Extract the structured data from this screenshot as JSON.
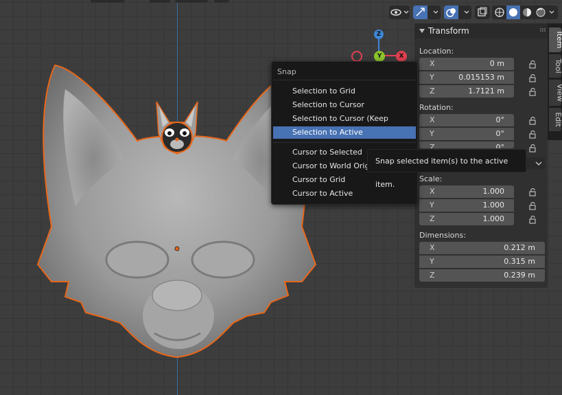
{
  "snap_menu": {
    "title": "Snap",
    "items": [
      {
        "label": "Selection to Grid"
      },
      {
        "label": "Selection to Cursor"
      },
      {
        "label": "Selection to Cursor (Keep Offset)"
      },
      {
        "label": "Selection to Active"
      },
      {
        "label": "Cursor to Selected"
      },
      {
        "label": "Cursor to World Origin"
      },
      {
        "label": "Cursor to Grid"
      },
      {
        "label": "Cursor to Active"
      }
    ]
  },
  "tooltip": "Snap selected item(s) to the active item.",
  "gizmo": {
    "z": "Z",
    "y": "Y",
    "x": "X"
  },
  "panel": {
    "title": "Transform",
    "location": {
      "label": "Location:",
      "x": "0 m",
      "y": "0.015153 m",
      "z": "1.7121 m"
    },
    "rotation": {
      "label": "Rotation:",
      "x": "0°",
      "y": "0°",
      "z": "0°"
    },
    "scale": {
      "label": "Scale:",
      "x": "1.000",
      "y": "1.000",
      "z": "1.000"
    },
    "dimensions": {
      "label": "Dimensions:",
      "x": "0.212 m",
      "y": "0.315 m",
      "z": "0.239 m"
    },
    "axis": {
      "x": "X",
      "y": "Y",
      "z": "Z"
    }
  },
  "tabs": [
    {
      "label": "Item"
    },
    {
      "label": "Tool"
    },
    {
      "label": "View"
    },
    {
      "label": "Edit"
    }
  ],
  "colors": {
    "accent": "#4772b3",
    "selection_outline": "#e8671a",
    "gizmo_x": "#e04050",
    "gizmo_y": "#8bc42a",
    "gizmo_z": "#3d86d6"
  }
}
